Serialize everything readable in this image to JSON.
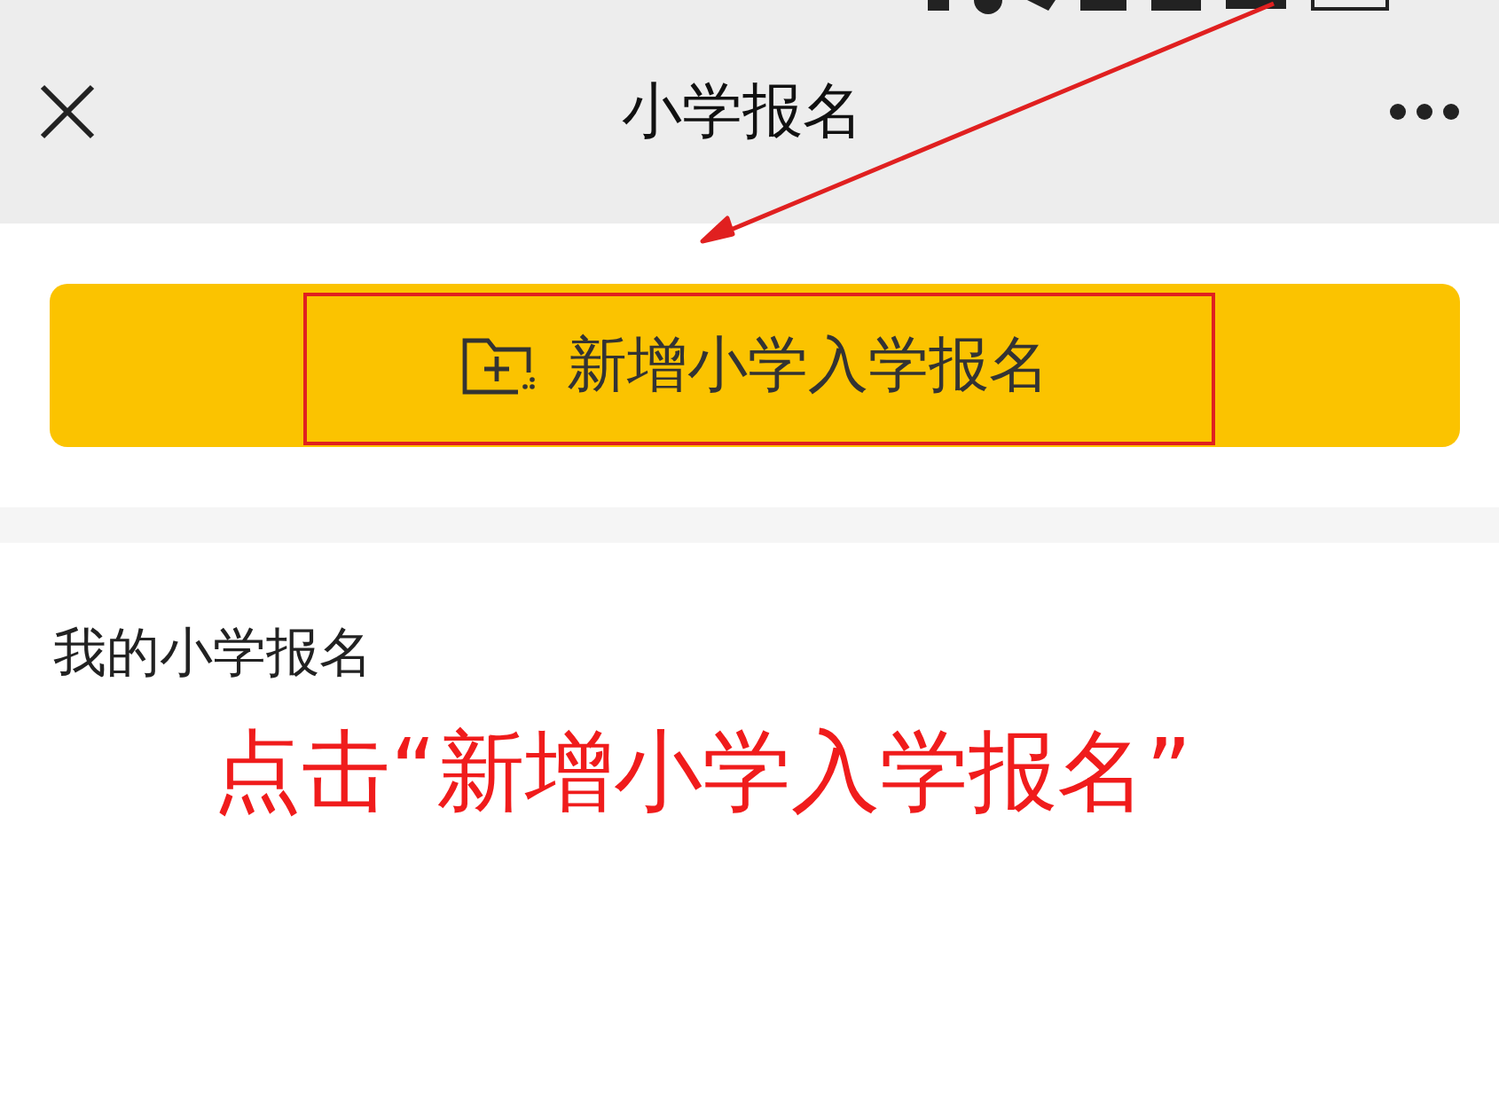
{
  "nav_bar": {
    "title": "小学报名"
  },
  "new_button": {
    "label": "新增小学入学报名"
  },
  "section": {
    "title": "我的小学报名"
  },
  "annotation": {
    "text": "点击“新增小学入学报名”"
  }
}
